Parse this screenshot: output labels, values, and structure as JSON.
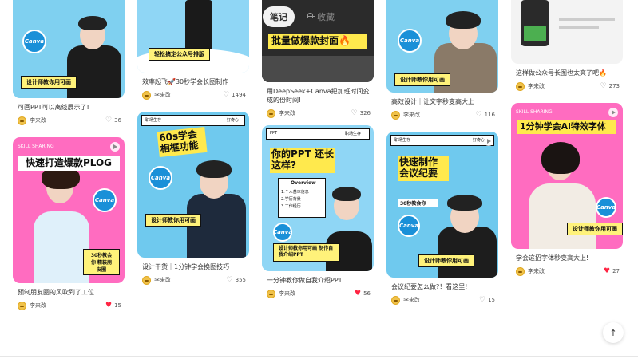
{
  "tabs": [
    {
      "label": "笔记",
      "active": true
    },
    {
      "label": "收藏",
      "active": false
    }
  ],
  "columns": [
    [
      {
        "cover": {
          "theme": "canva-top",
          "bg": "#7fd0f0",
          "strip": "设计师教你用可画",
          "badge": "Canva"
        },
        "title": "可画PPT可以离线展示了!",
        "author": "李来改",
        "likes": "36",
        "liked": false
      },
      {
        "cover": {
          "theme": "plog",
          "bg": "#ff6cc0",
          "headline": "快速打造爆款PLOG",
          "sub": "SKILL SHARING",
          "strip": "30秒教会你 精装朋友圈",
          "badge": "Canva"
        },
        "title": "预制朋友圈的风吹到了工位......",
        "author": "李来改",
        "likes": "15",
        "liked": true
      }
    ],
    [
      {
        "cover": {
          "theme": "top-white",
          "bg": "#8fd6f5",
          "strip": "轻松搞定公众号排版"
        },
        "title": "效率起飞🚀30秒学会长图制作",
        "author": "李来改",
        "likes": "1494",
        "liked": false
      },
      {
        "cover": {
          "theme": "frame",
          "bg": "#6fc9ee",
          "headline": "60s学会 相框功能",
          "label_left": "职场生存",
          "label_right": "好奇心",
          "strip": "设计师教你用可画",
          "badge": "Canva"
        },
        "title": "设计干货｜1分钟学会换图技巧",
        "author": "李来改",
        "likes": "355",
        "liked": false
      }
    ],
    [
      {
        "cover": {
          "theme": "dark-top",
          "bg": "#2b2b2b",
          "headline": "批量做爆款封面🔥"
        },
        "title": "用DeepSeek+Canva把加班时间变成的份时间!",
        "author": "李来改",
        "likes": "326",
        "liked": false
      },
      {
        "cover": {
          "theme": "ppt",
          "bg": "#8fd6f5",
          "headline": "你的PPT 还长这样?",
          "label_left": "PPT",
          "label_right": "职场生存",
          "list_title": "Overview",
          "list": [
            "1.个人基本信息",
            "2.学历背景",
            "3.工作经历"
          ],
          "strip": "设计师教你用可画 制作自我介绍PPT",
          "badge": "Canva"
        },
        "title": "一分钟教你做自我介绍PPT",
        "author": "李来改",
        "likes": "56",
        "liked": true
      }
    ],
    [
      {
        "cover": {
          "theme": "canva-top",
          "bg": "#7fd0f0",
          "strip": "设计师教你用可画",
          "badge": "Canva"
        },
        "title": "高效设计｜让文字秒变高大上",
        "author": "李来改",
        "likes": "116",
        "liked": false
      },
      {
        "cover": {
          "theme": "meeting",
          "bg": "#6fc9ee",
          "headline": "快速制作 会议纪要",
          "label_left": "职场生存",
          "label_right": "好奇心",
          "sub2": "30秒教会你",
          "strip": "设计师教你用可画",
          "badge": "Canva"
        },
        "title": "会议纪要怎么做?！看这里!",
        "author": "李来改",
        "likes": "15",
        "liked": false
      }
    ],
    [
      {
        "cover": {
          "theme": "phone-top",
          "bg": "#f3f3f3"
        },
        "title": "这样做公众号长图也太爽了吧🔥",
        "author": "李来改",
        "likes": "273",
        "liked": false
      },
      {
        "cover": {
          "theme": "ai",
          "bg": "#ff6cc0",
          "headline": "1分钟学会Ai特效字体",
          "sub": "SKILL SHARING",
          "strip": "设计师教你用可画",
          "badge": "Canva"
        },
        "title": "学会这招字体秒变高大上!",
        "author": "李来改",
        "likes": "27",
        "liked": true
      }
    ]
  ],
  "colors": {
    "accent": "#ff2442",
    "strip": "#fff27a",
    "canva": "#1a90d8"
  },
  "icons": {
    "back_to_top": "arrow-up-icon",
    "like": "heart-icon",
    "lock": "lock-icon"
  }
}
